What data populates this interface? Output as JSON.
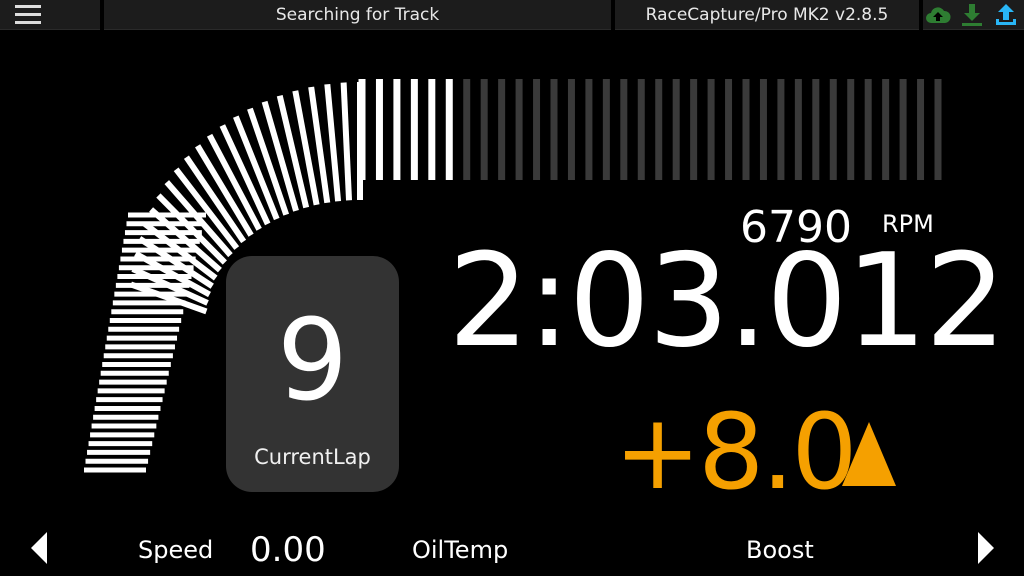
{
  "topbar": {
    "status_text": "Searching for Track",
    "device_text": "RaceCapture/Pro MK2 v2.8.5",
    "icons": [
      "menu-icon",
      "cloud-upload-icon",
      "download-icon",
      "upload-icon"
    ],
    "icon_colors": {
      "cloud": "#2e7d32",
      "download": "#2e7d32",
      "upload": "#29b6f6"
    }
  },
  "tach": {
    "rpm_value": "6790",
    "rpm_label": "RPM",
    "lit_fraction": 0.67
  },
  "lap": {
    "time": "2:03.012",
    "delta": "+8.0",
    "delta_direction": "up",
    "delta_color": "#f5a000",
    "current_lap_number": "9",
    "current_lap_label": "CurrentLap"
  },
  "bottom": {
    "speed_label": "Speed",
    "speed_value": "0.00",
    "oiltemp_label": "OilTemp",
    "boost_label": "Boost"
  }
}
